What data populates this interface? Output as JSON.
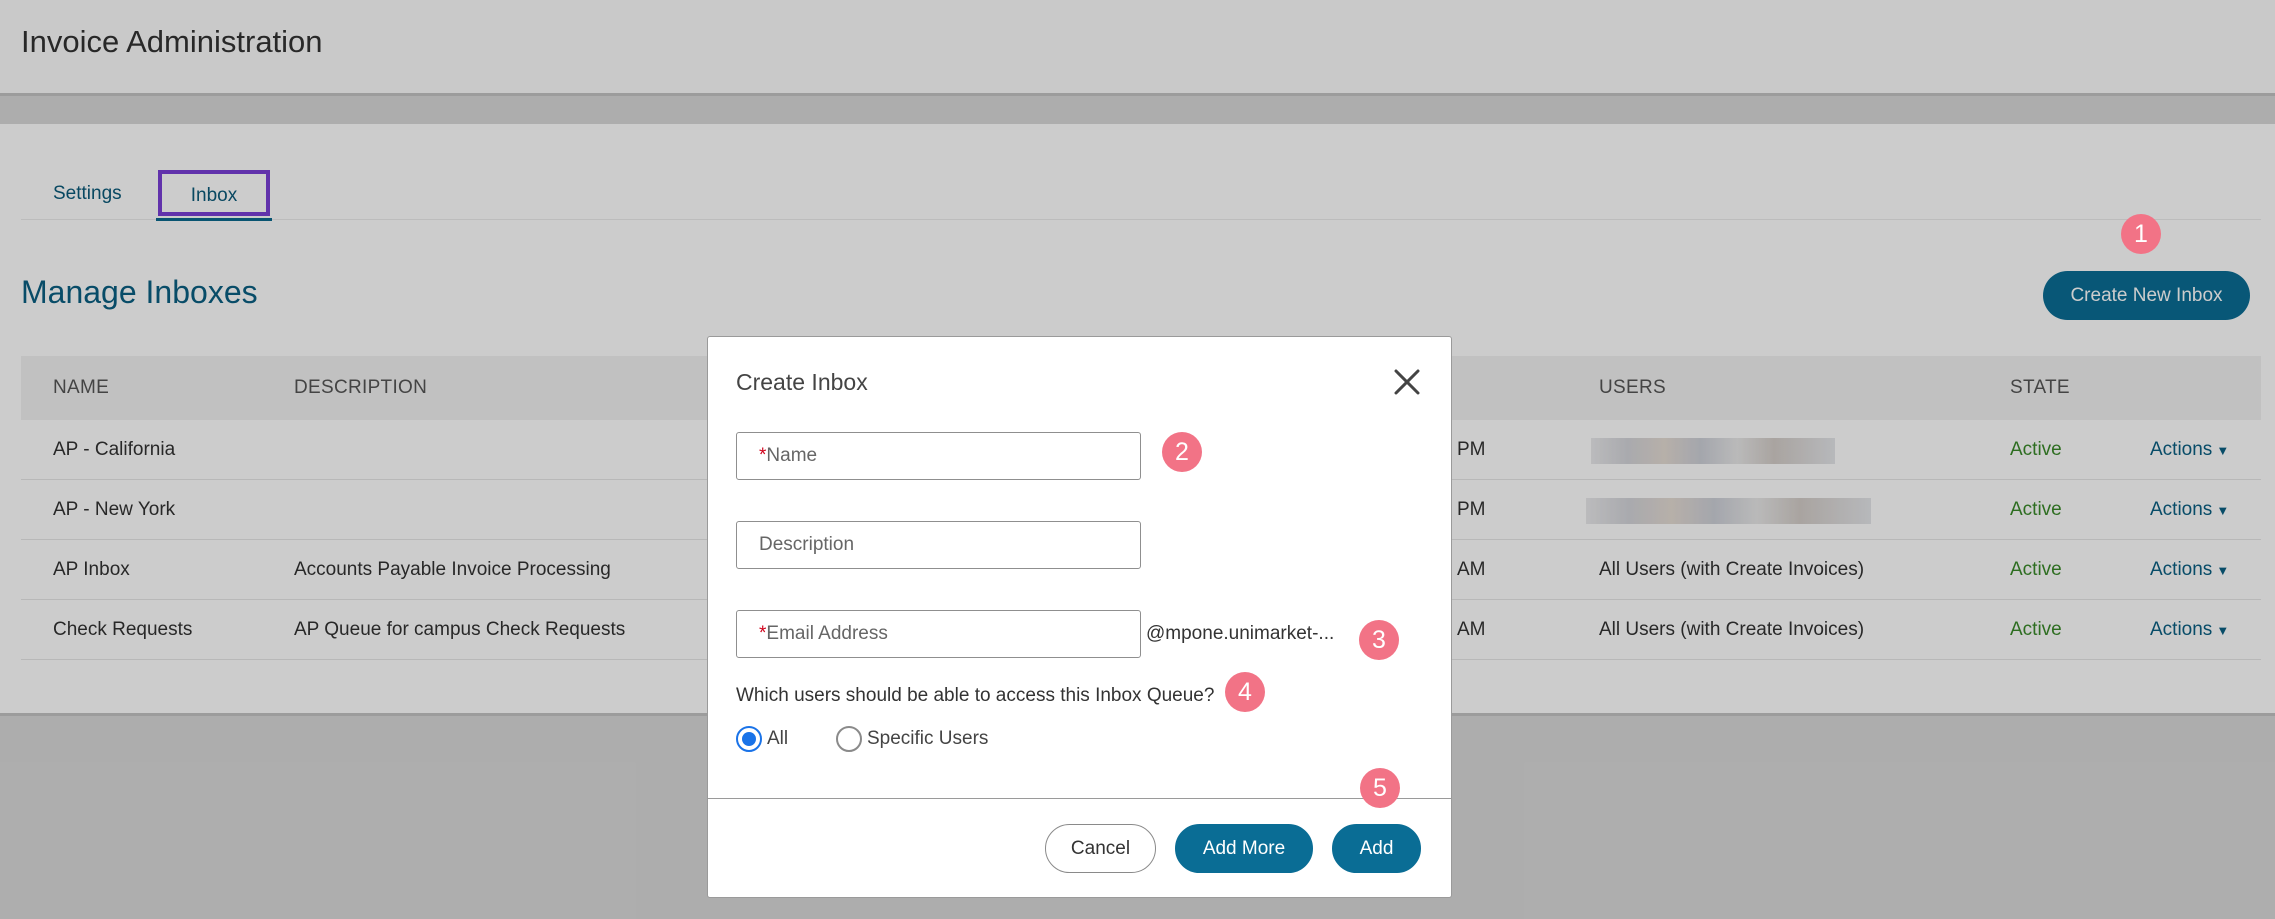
{
  "header": {
    "title": "Invoice Administration"
  },
  "tabs": [
    {
      "label": "Settings"
    },
    {
      "label": "Inbox",
      "active": true
    }
  ],
  "section": {
    "title": "Manage Inboxes",
    "create_button": "Create New Inbox"
  },
  "table": {
    "columns": [
      "NAME",
      "DESCRIPTION",
      "USERS",
      "STATE"
    ],
    "rows": [
      {
        "name": "AP - California",
        "description": "",
        "time": "PM",
        "users": "",
        "state": "Active",
        "actions": "Actions"
      },
      {
        "name": "AP - New York",
        "description": "",
        "time": "PM",
        "users": "",
        "state": "Active",
        "actions": "Actions"
      },
      {
        "name": "AP Inbox",
        "description": "Accounts Payable Invoice Processing",
        "time": "AM",
        "users": "All Users (with Create Invoices)",
        "state": "Active",
        "actions": "Actions"
      },
      {
        "name": "Check Requests",
        "description": "AP Queue for campus Check Requests",
        "time": "AM",
        "users": "All Users (with Create Invoices)",
        "state": "Active",
        "actions": "Actions"
      }
    ]
  },
  "modal": {
    "title": "Create Inbox",
    "name_placeholder": "Name",
    "description_placeholder": "Description",
    "email_placeholder": "Email Address",
    "email_suffix": "@mpone.unimarket-...",
    "question": "Which users should be able to access this Inbox Queue?",
    "options": [
      {
        "label": "All",
        "checked": true
      },
      {
        "label": "Specific Users",
        "checked": false
      }
    ],
    "buttons": {
      "cancel": "Cancel",
      "add_more": "Add More",
      "add": "Add"
    }
  },
  "markers": [
    "1",
    "2",
    "3",
    "4",
    "5"
  ],
  "colors": {
    "primary": "#0a6d95",
    "active_state": "#3a8a2a",
    "marker": "#f27386",
    "tab_highlight": "#7a3fd6",
    "required": "#d0021b"
  }
}
